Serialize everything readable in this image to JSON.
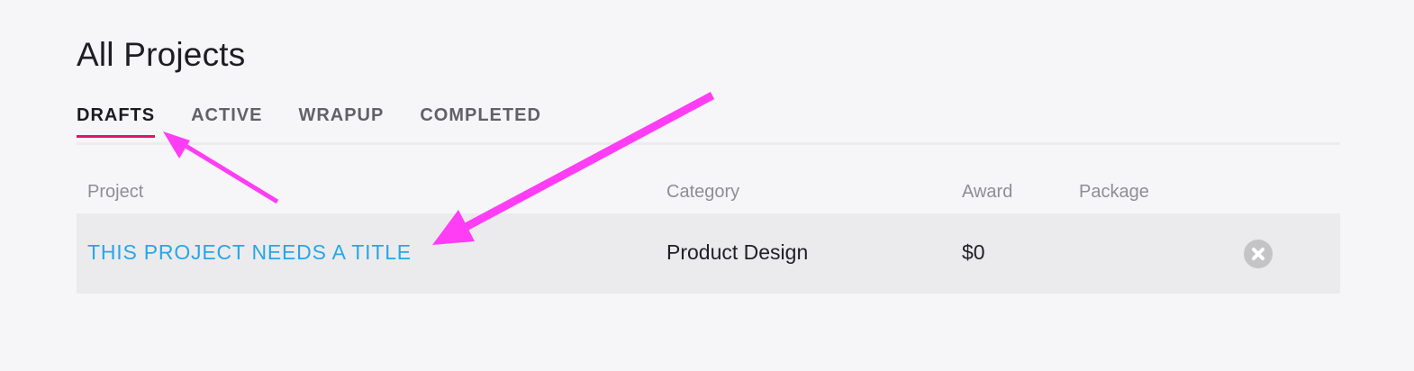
{
  "page": {
    "title": "All Projects"
  },
  "tabs": [
    {
      "label": "DRAFTS",
      "active": true
    },
    {
      "label": "ACTIVE",
      "active": false
    },
    {
      "label": "WRAPUP",
      "active": false
    },
    {
      "label": "COMPLETED",
      "active": false
    }
  ],
  "table": {
    "headers": {
      "project": "Project",
      "category": "Category",
      "award": "Award",
      "package": "Package"
    },
    "rows": [
      {
        "project": "THIS PROJECT NEEDS A TITLE",
        "category": "Product Design",
        "award": "$0",
        "package": "",
        "action_icon": "close-circle-icon"
      }
    ]
  },
  "colors": {
    "accent": "#e0146c",
    "link": "#28a6e8",
    "annotation_arrow": "#ff3df5",
    "row_background": "#ebebed",
    "page_background": "#f6f6f8"
  }
}
